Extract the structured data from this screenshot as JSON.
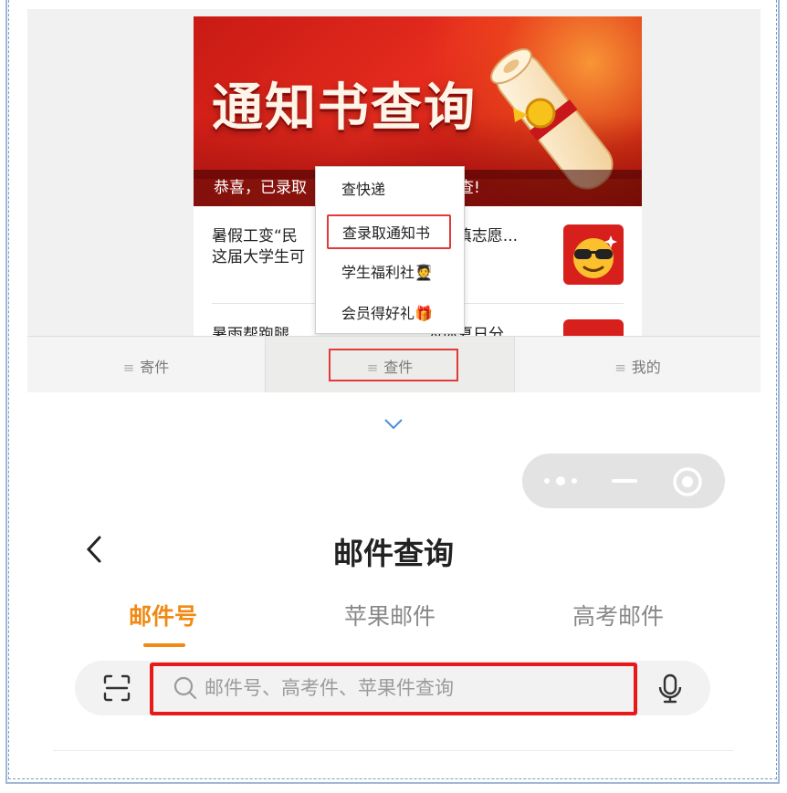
{
  "banner": {
    "title": "通知书查询",
    "caption": "恭喜，已录取",
    "caption_tail": "查!"
  },
  "news": [
    {
      "title_line1": "暑假工变“民",
      "title_line1_tail": "亲戚填志愿...",
      "title_line2": "这届大学生可"
    },
    {
      "title": "暑雨帮跑腿",
      "title_tail": "为你夏日分"
    }
  ],
  "popup_menu": {
    "items": [
      "查快递",
      "查录取通知书",
      "学生福利社🧑‍🎓",
      "会员得好礼🎁"
    ],
    "highlighted_index": 1
  },
  "bottom_tabs": {
    "items": [
      "寄件",
      "查件",
      "我的"
    ],
    "active_index": 1,
    "menu_glyph": "≡"
  },
  "page": {
    "title": "邮件查询"
  },
  "query_tabs": {
    "items": [
      "邮件号",
      "苹果邮件",
      "高考邮件"
    ],
    "active_index": 0
  },
  "search": {
    "placeholder": "邮件号、高考件、苹果件查询",
    "value": ""
  },
  "colors": {
    "accent": "#f08a14",
    "highlight_red": "#e8191a",
    "banner_red": "#d7201b"
  }
}
